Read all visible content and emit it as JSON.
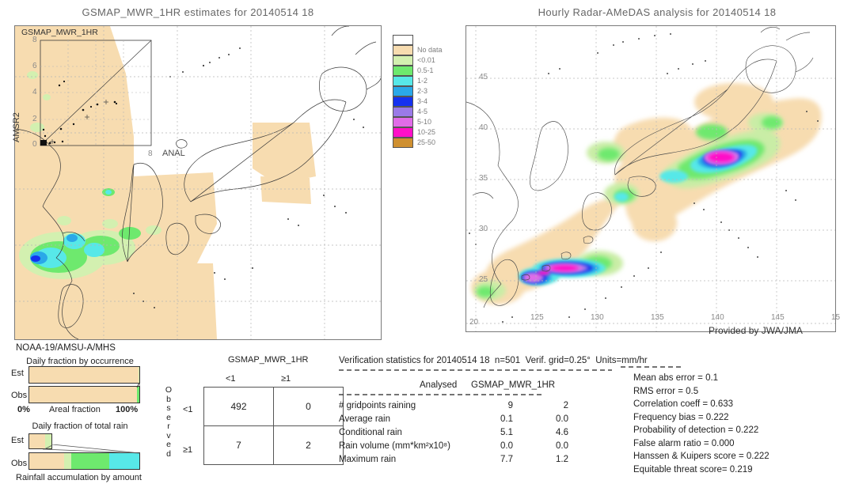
{
  "left_panel": {
    "title": "GSMAP_MWR_1HR estimates for 20140514 18",
    "inset_label": "GSMAP_MWR_1HR",
    "y_axis_label": "AMSR2",
    "footer_label": "NOAA-19/AMSU-A/MHS",
    "anal_label": "ANAL",
    "scatter_y_ticks": [
      "8",
      "6",
      "4",
      "2",
      "0"
    ],
    "scatter_x_tick": "8"
  },
  "right_panel": {
    "title": "Hourly Radar-AMeDAS analysis for 20140514 18",
    "credit": "Provided by JWA/JMA",
    "x_ticks": [
      "125",
      "130",
      "135",
      "140",
      "145",
      "15"
    ],
    "y_ticks": [
      "45",
      "40",
      "35",
      "30",
      "25",
      "20"
    ]
  },
  "legend": {
    "items": [
      {
        "label": "",
        "color": "#ffffff"
      },
      {
        "label": "No data",
        "color": "#f7dcb0"
      },
      {
        "label": "<0.01",
        "color": "#d3f0b0"
      },
      {
        "label": "0.5-1",
        "color": "#6ee96e"
      },
      {
        "label": "1-2",
        "color": "#57e8e8"
      },
      {
        "label": "2-3",
        "color": "#2aa8e8"
      },
      {
        "label": "3-4",
        "color": "#1531ef"
      },
      {
        "label": "4-5",
        "color": "#9a7ae8"
      },
      {
        "label": "5-10",
        "color": "#e06ce8"
      },
      {
        "label": "10-25",
        "color": "#ff10c8"
      },
      {
        "label": "25-50",
        "color": "#cf9030"
      }
    ]
  },
  "occurrence_chart": {
    "title": "Daily fraction by occurrence",
    "row_labels": [
      "Est",
      "Obs"
    ],
    "x_left": "0%",
    "x_center": "Areal fraction",
    "x_right": "100%",
    "est_segments": [
      {
        "color": "#f7dcb0",
        "pct": 99.6
      },
      {
        "color": "#d3f0b0",
        "pct": 0.4
      }
    ],
    "obs_segments": [
      {
        "color": "#f7dcb0",
        "pct": 97.6
      },
      {
        "color": "#6ee96e",
        "pct": 2.4
      }
    ]
  },
  "total_rain_chart": {
    "title": "Daily fraction of total rain",
    "row_labels": [
      "Est",
      "Obs"
    ],
    "x_label": "Rainfall accumulation by amount",
    "est_segments": [
      {
        "color": "#f7dcb0",
        "pct": 15.0
      },
      {
        "color": "#d3f0b0",
        "pct": 6.5
      }
    ],
    "obs_segments": [
      {
        "color": "#f7dcb0",
        "pct": 32.0
      },
      {
        "color": "#d3f0b0",
        "pct": 6.0
      },
      {
        "color": "#6ee96e",
        "pct": 35.0
      },
      {
        "color": "#57e8e8",
        "pct": 27.0
      }
    ]
  },
  "contingency_table": {
    "title": "GSMAP_MWR_1HR",
    "col_headers": [
      "<1",
      "≧1"
    ],
    "col_headers_display": [
      "<1",
      "≥1"
    ],
    "row_headers": [
      "<1",
      "≥1"
    ],
    "side_label": "Observed",
    "cells": [
      [
        "492",
        "0"
      ],
      [
        "7",
        "2"
      ]
    ]
  },
  "verification": {
    "header": "Verification statistics for 20140514 18  n=501  Verif. grid=0.25°  Units=mm/hr",
    "divider": "-----------------------------------------------",
    "col_head_left": "Analysed",
    "col_head_right": "GSMAP_MWR_1HR",
    "sub_divider": "------------------------------",
    "rows": [
      {
        "label": "# gridpoints raining",
        "analysed": "9",
        "model": "2"
      },
      {
        "label": "Average rain",
        "analysed": "0.1",
        "model": "0.0"
      },
      {
        "label": "Conditional rain",
        "analysed": "5.1",
        "model": "4.6"
      },
      {
        "label": "Rain volume (mm*km²x10⁸)",
        "analysed": "0.0",
        "model": "0.0"
      },
      {
        "label": "Maximum rain",
        "analysed": "7.7",
        "model": "1.2"
      }
    ],
    "scores_divider": "---------",
    "scores": [
      "Mean abs error = 0.1",
      "RMS error = 0.5",
      "Correlation coeff = 0.633",
      "Frequency bias = 0.222",
      "Probability of detection = 0.222",
      "False alarm ratio = 0.000",
      "Hanssen & Kuipers score = 0.222",
      "Equitable threat score= 0.219"
    ]
  }
}
